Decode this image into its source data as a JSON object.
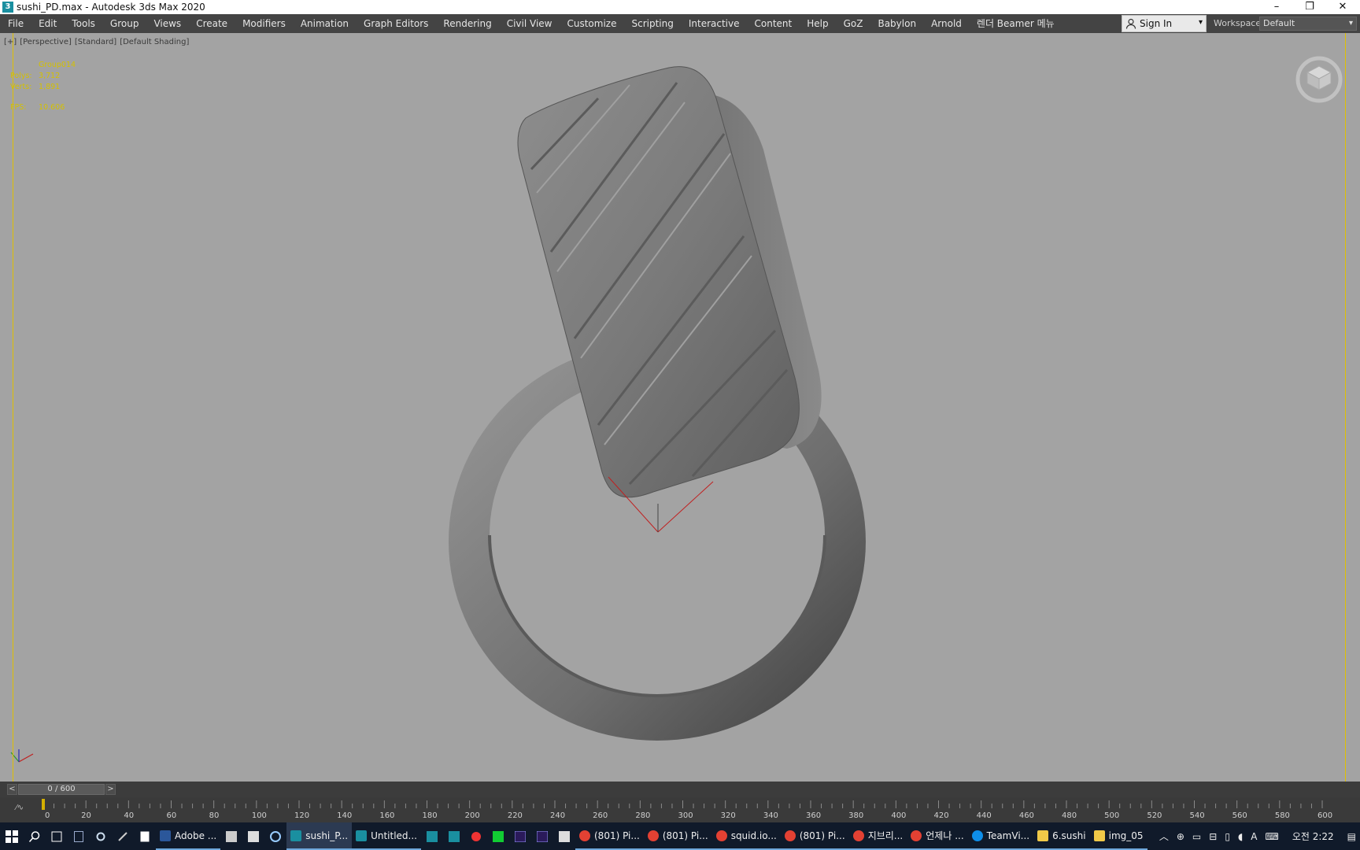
{
  "window": {
    "title": "sushi_PD.max - Autodesk 3ds Max 2020",
    "app_icon_letter": "3",
    "controls": [
      "–",
      "❐",
      "✕"
    ]
  },
  "menu": {
    "items": [
      "File",
      "Edit",
      "Tools",
      "Group",
      "Views",
      "Create",
      "Modifiers",
      "Animation",
      "Graph Editors",
      "Rendering",
      "Civil View",
      "Customize",
      "Scripting",
      "Interactive",
      "Content",
      "Help",
      "GoZ",
      "Babylon",
      "Arnold",
      "렌더 Beamer 메뉴"
    ],
    "sign_in": "Sign In",
    "workspaces_label": "Workspaces:",
    "workspace_value": "Default"
  },
  "viewport": {
    "labels": [
      "[+]",
      "[Perspective]",
      "[Standard]",
      "[Default Shading]"
    ],
    "object_name": "Group014",
    "stats": [
      {
        "key": "Polys:",
        "value": "3,712"
      },
      {
        "key": "Verts:",
        "value": "1,891"
      }
    ],
    "fps_key": "FPS:",
    "fps_value": "10.606",
    "colors": {
      "background": "#a3a3a3",
      "stats": "#d4c000",
      "active_border": "#e0c000"
    }
  },
  "timeline": {
    "frame_display": "0 / 600",
    "prev": "<",
    "next": ">",
    "ticks": [
      "0",
      "20",
      "40",
      "60",
      "80",
      "100",
      "120",
      "140",
      "160",
      "180",
      "200",
      "220",
      "240",
      "260",
      "280",
      "300",
      "320",
      "340",
      "360",
      "380",
      "400",
      "420",
      "440",
      "460",
      "480",
      "500",
      "520",
      "540",
      "560",
      "580",
      "600"
    ]
  },
  "taskbar": {
    "apps": [
      {
        "label": "Adobe ...",
        "color": "#2b579a",
        "icon": "adobe-icon"
      },
      {
        "label": "sushi_P...",
        "color": "#1a8fa0",
        "icon": "3dsmax-icon",
        "active": true
      },
      {
        "label": "Untitled...",
        "color": "#1a8fa0",
        "icon": "3dsmax-icon"
      },
      {
        "label": "(801) Pi...",
        "color": "#e34133",
        "icon": "chrome-icon"
      },
      {
        "label": "(801) Pi...",
        "color": "#e34133",
        "icon": "chrome-icon"
      },
      {
        "label": "squid.io...",
        "color": "#e34133",
        "icon": "chrome-icon"
      },
      {
        "label": "(801) Pi...",
        "color": "#e34133",
        "icon": "chrome-icon"
      },
      {
        "label": "지브리...",
        "color": "#e34133",
        "icon": "chrome-icon"
      },
      {
        "label": "언제나 ...",
        "color": "#e34133",
        "icon": "chrome-icon"
      },
      {
        "label": "TeamVi...",
        "color": "#0e8ee9",
        "icon": "teamviewer-icon"
      },
      {
        "label": "6.sushi",
        "color": "#f0c948",
        "icon": "folder-icon"
      },
      {
        "label": "img_05",
        "color": "#f0c948",
        "icon": "folder-icon"
      }
    ],
    "clock": "오전 2:22"
  }
}
